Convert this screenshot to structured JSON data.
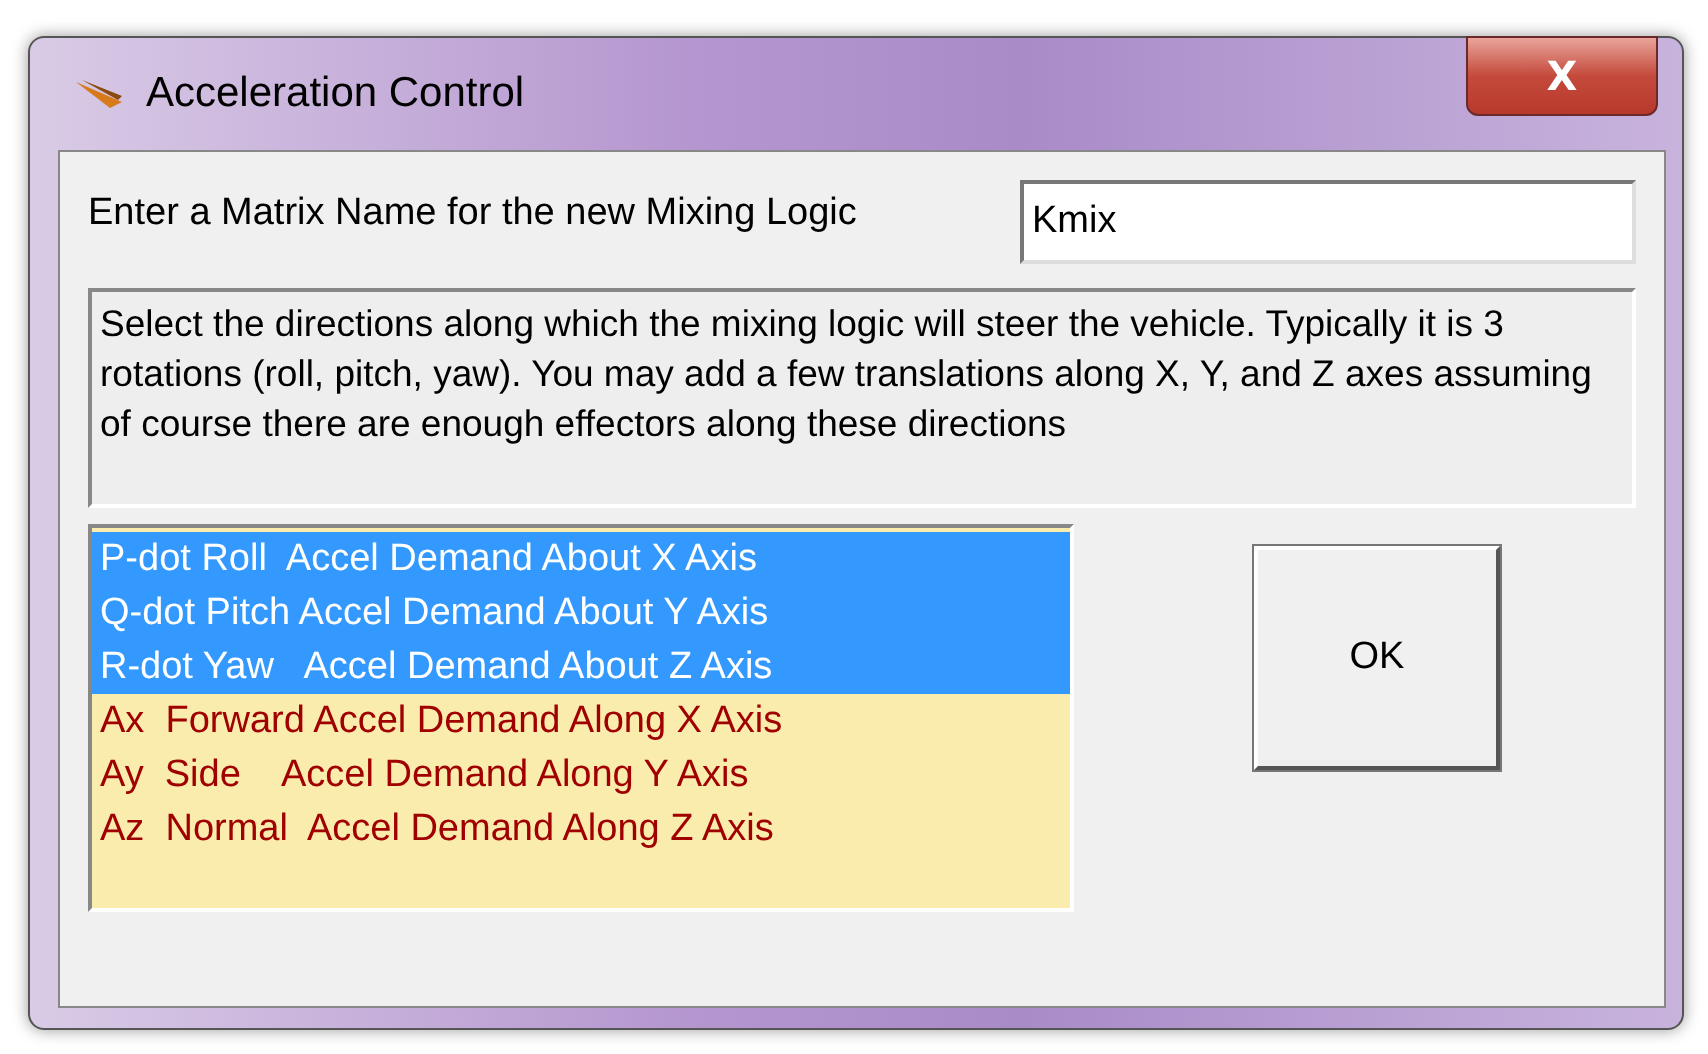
{
  "window": {
    "title": "Acceleration Control",
    "close": "X"
  },
  "matrix_name": {
    "label": "Enter a Matrix Name for the new Mixing Logic",
    "value": "Kmix"
  },
  "description": "Select the directions along which the mixing logic will steer the vehicle. Typically it is 3 rotations (roll, pitch,  yaw). You may add a few translations along X, Y, and Z axes assuming of course there are enough effectors along these directions",
  "directions": [
    {
      "label": "P-dot Roll  Accel Demand About X Axis",
      "selected": true
    },
    {
      "label": "Q-dot Pitch Accel Demand About Y Axis",
      "selected": true
    },
    {
      "label": "R-dot Yaw   Accel Demand About Z Axis",
      "selected": true
    },
    {
      "label": "Ax  Forward Accel Demand Along X Axis",
      "selected": false
    },
    {
      "label": "Ay  Side    Accel Demand Along Y Axis",
      "selected": false
    },
    {
      "label": "Az  Normal  Accel Demand Along Z Axis",
      "selected": false
    }
  ],
  "ok_button": "OK"
}
